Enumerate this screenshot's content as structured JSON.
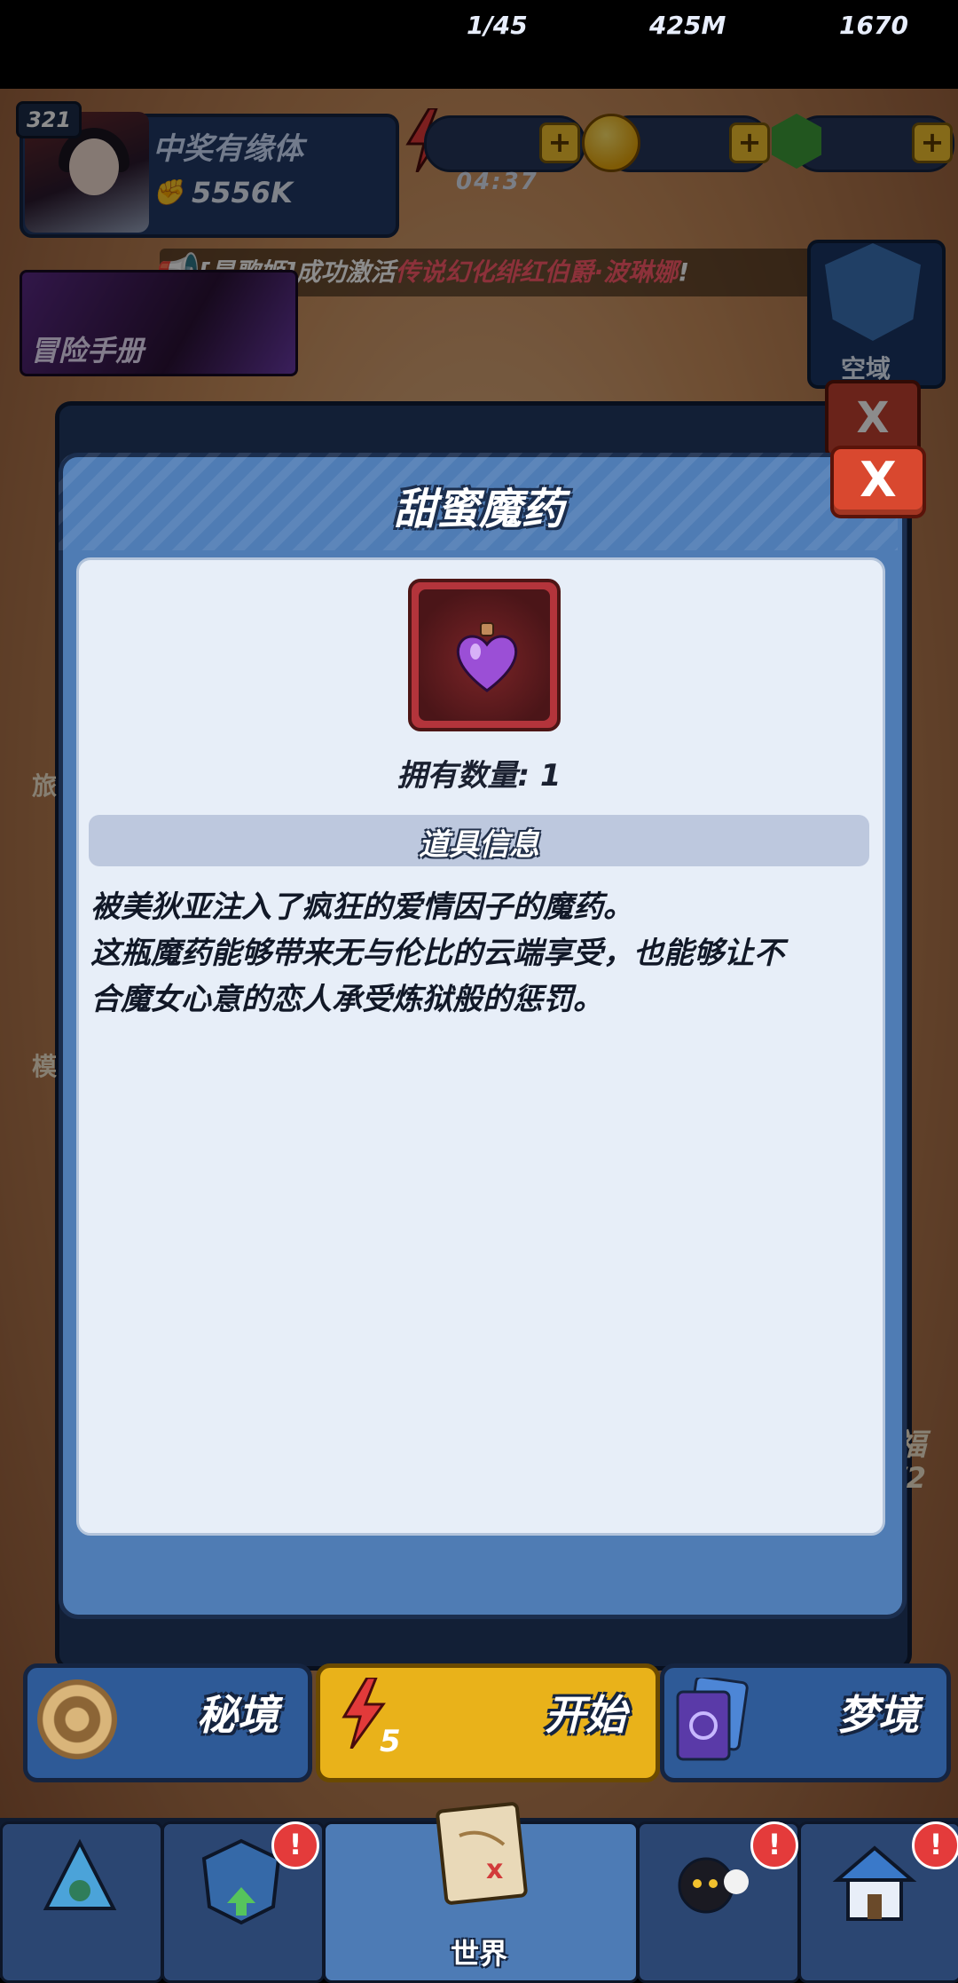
{
  "hud": {
    "level": "321",
    "player_name": "中奖有缘体",
    "power": "5556K",
    "energy": "1/45",
    "energy_timer": "04:37",
    "coins": "425M",
    "gems": "1670",
    "plus": "+"
  },
  "ticker": {
    "prefix": "[是歌姬]成功激活",
    "highlight": "传说幻化绯红伯爵·波琳娜",
    "suffix": "!"
  },
  "side": {
    "handbook": "冒险手册",
    "skyzone": "空域",
    "left_partial_1": "旅",
    "left_partial_2": "模",
    "right_partial_1": "福",
    "right_partial_2": "/2"
  },
  "modal": {
    "title": "甜蜜魔药",
    "close": "X",
    "owned_label": "拥有数量: 1",
    "info_header": "道具信息",
    "description_line1": "被美狄亚注入了疯狂的爱情因子的魔药。",
    "description_line2": "这瓶魔药能够带来无与伦比的云端享受，也能够让不",
    "description_line3": "合魔女心意的恋人承受炼狱般的惩罚。"
  },
  "backpack": {
    "close": "X"
  },
  "bottom_buttons": {
    "secret": "秘境",
    "start": "开始",
    "start_cost": "5",
    "dream": "梦境"
  },
  "nav": {
    "world": "世界",
    "badge": "!"
  },
  "colors": {
    "modal_blue": "#4f7cb4",
    "close_red": "#d9482f",
    "start_yellow": "#e9b21a",
    "highlight_red": "#ff5a6a"
  }
}
